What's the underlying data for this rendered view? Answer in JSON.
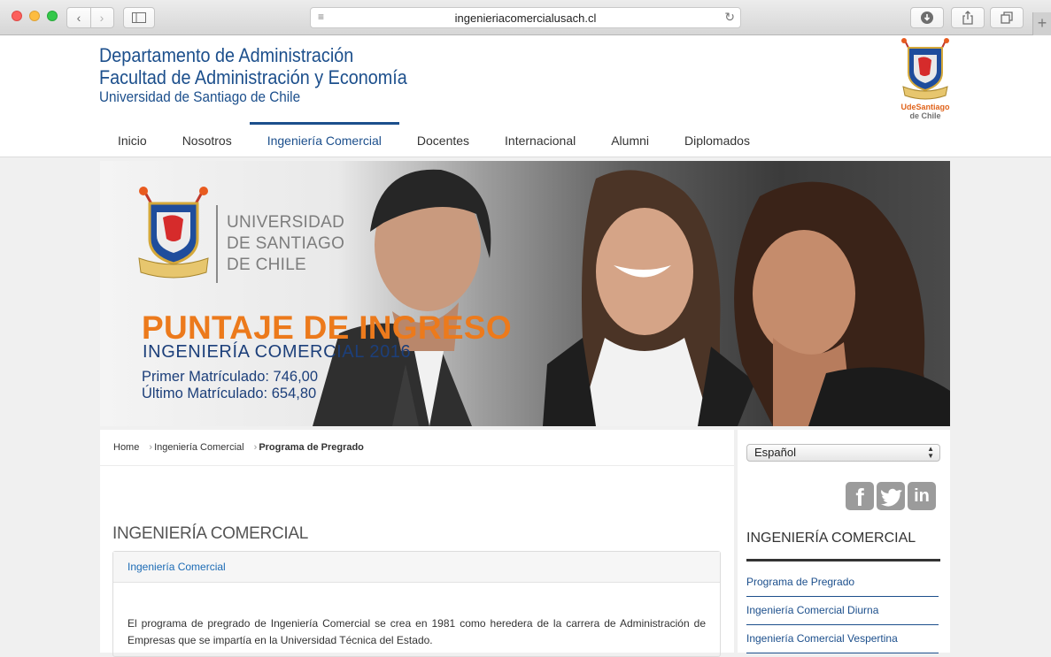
{
  "browser": {
    "url": "ingenieriacomercialusach.cl",
    "new_tab_symbol": "+"
  },
  "header": {
    "line1": "Departamento de Administración",
    "line2": "Facultad de Administración y Economía",
    "line3": "Universidad de Santiago de Chile",
    "logo_text_1": "UdeSantiago",
    "logo_text_2": "de Chile"
  },
  "nav": {
    "items": [
      {
        "label": "Inicio"
      },
      {
        "label": "Nosotros"
      },
      {
        "label": "Ingeniería Comercial"
      },
      {
        "label": "Docentes"
      },
      {
        "label": "Internacional"
      },
      {
        "label": "Alumni"
      },
      {
        "label": "Diplomados"
      }
    ],
    "active_index": 2
  },
  "banner": {
    "uni_line1": "UNIVERSIDAD",
    "uni_line2": "DE SANTIAGO",
    "uni_line3": "DE CHILE",
    "title": "PUNTAJE DE INGRESO",
    "subtitle": "INGENIERÍA COMERCIAL 2016",
    "first_score": "Primer Matrículado: 746,00",
    "last_score": "Último Matrículado: 654,80",
    "title_color": "#ec7a1c",
    "text_color": "#1c3f7a"
  },
  "breadcrumb": {
    "home": "Home",
    "level1": "Ingeniería Comercial",
    "current": "Programa de Pregrado"
  },
  "content": {
    "title": "INGENIERÍA COMERCIAL",
    "panel_heading": "Ingeniería Comercial",
    "body": "El programa de pregrado de Ingeniería Comercial se crea en 1981 como heredera de la carrera de Administración de Empresas que se impartía en la Universidad Técnica del Estado."
  },
  "sidebar": {
    "language": "Español",
    "social": [
      {
        "icon": "facebook-icon",
        "glyph": "f"
      },
      {
        "icon": "twitter-icon",
        "glyph": "t"
      },
      {
        "icon": "linkedin-icon",
        "glyph": "in"
      }
    ],
    "title": "INGENIERÍA COMERCIAL",
    "links": [
      {
        "label": "Programa de Pregrado"
      },
      {
        "label": "Ingeniería Comercial Diurna"
      },
      {
        "label": "Ingeniería Comercial Vespertina"
      }
    ]
  },
  "colors": {
    "brand_blue": "#1c4f8c",
    "accent_orange": "#ec7a1c"
  }
}
